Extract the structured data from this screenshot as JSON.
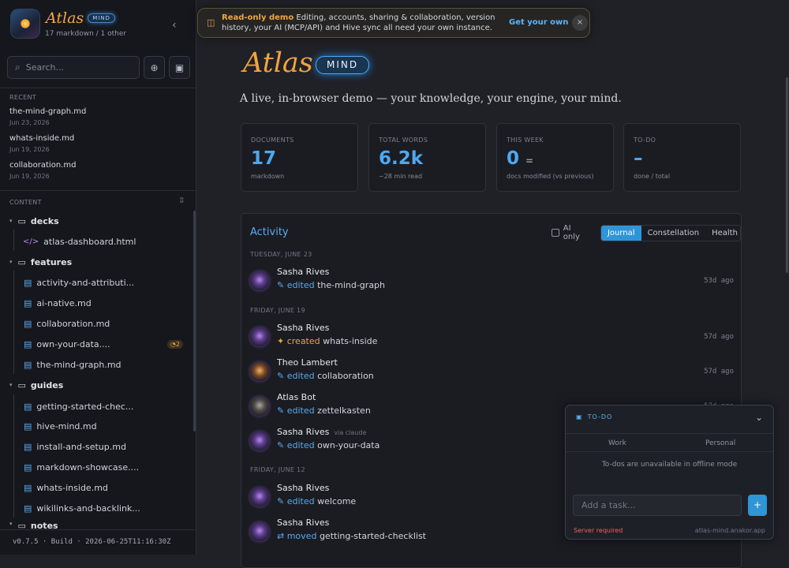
{
  "sidebar": {
    "app_name": "Atlas",
    "app_badge": "MIND",
    "doc_count": "17 markdown / 1 other",
    "search_placeholder": "Search...",
    "recent_label": "RECENT",
    "recent": [
      {
        "name": "the-mind-graph.md",
        "date": "Jun 23, 2026"
      },
      {
        "name": "whats-inside.md",
        "date": "Jun 19, 2026"
      },
      {
        "name": "collaboration.md",
        "date": "Jun 19, 2026"
      }
    ],
    "content_label": "CONTENT",
    "tree": [
      {
        "type": "folder",
        "label": "decks"
      },
      {
        "type": "html",
        "label": "atlas-dashboard.html"
      },
      {
        "type": "folder",
        "label": "features"
      },
      {
        "type": "file",
        "label": "activity-and-attributi..."
      },
      {
        "type": "file",
        "label": "ai-native.md"
      },
      {
        "type": "file",
        "label": "collaboration.md"
      },
      {
        "type": "file",
        "label": "own-your-data....",
        "comments": "2"
      },
      {
        "type": "file",
        "label": "the-mind-graph.md"
      },
      {
        "type": "folder",
        "label": "guides"
      },
      {
        "type": "file",
        "label": "getting-started-chec..."
      },
      {
        "type": "file",
        "label": "hive-mind.md"
      },
      {
        "type": "file",
        "label": "install-and-setup.md"
      },
      {
        "type": "file",
        "label": "markdown-showcase...."
      },
      {
        "type": "file",
        "label": "whats-inside.md"
      },
      {
        "type": "file",
        "label": "wikilinks-and-backlink..."
      },
      {
        "type": "folder",
        "label": "notes"
      }
    ],
    "footer": "v0.7.5 · Build · 2026-06-25T11:16:30Z"
  },
  "banner": {
    "bold": "Read-only demo",
    "text": "Editing, accounts, sharing & collaboration, version history, your AI (MCP/API) and Hive sync all need your own instance.",
    "cta": "Get your own ↗",
    "close": "×"
  },
  "hero": {
    "title": "Atlas",
    "badge": "MIND",
    "tagline": "A live, in-browser demo — your knowledge, your engine, your mind."
  },
  "stats": [
    {
      "label": "DOCUMENTS",
      "value": "17",
      "sub": "markdown"
    },
    {
      "label": "TOTAL WORDS",
      "value": "6.2k",
      "sub": "~28 min read"
    },
    {
      "label": "THIS WEEK",
      "value": "0",
      "delta": "=",
      "sub": "docs modified (vs previous)"
    },
    {
      "label": "TO-DO",
      "value": "–",
      "sub": "done / total"
    }
  ],
  "activity": {
    "title": "Activity",
    "ai_only": "AI only",
    "tabs": [
      "Journal",
      "Constellation",
      "Health"
    ],
    "active_tab": "Journal",
    "days": [
      {
        "day": "TUESDAY, JUNE 23",
        "entries": [
          {
            "name": "Sasha Rives",
            "verb": "edited",
            "target": "the-mind-graph",
            "when": "53d ago",
            "avatar": "purple"
          }
        ]
      },
      {
        "day": "FRIDAY, JUNE 19",
        "entries": [
          {
            "name": "Sasha Rives",
            "verb": "created",
            "target": "whats-inside",
            "when": "57d ago",
            "avatar": "purple"
          },
          {
            "name": "Theo Lambert",
            "verb": "edited",
            "target": "collaboration",
            "when": "57d ago",
            "avatar": "gold"
          },
          {
            "name": "Atlas Bot",
            "verb": "edited",
            "target": "zettelkasten",
            "when": "57d ago",
            "avatar": "bot"
          },
          {
            "name": "Sasha Rives",
            "via": "via claude",
            "verb": "edited",
            "target": "own-your-data",
            "when": "",
            "avatar": "purple"
          }
        ]
      },
      {
        "day": "FRIDAY, JUNE 12",
        "entries": [
          {
            "name": "Sasha Rives",
            "verb": "edited",
            "target": "welcome",
            "when": "",
            "avatar": "purple"
          },
          {
            "name": "Sasha Rives",
            "verb": "moved",
            "target": "getting-started-checklist",
            "when": "",
            "avatar": "purple"
          }
        ]
      }
    ]
  },
  "todo": {
    "title": "TO-DO",
    "tabs": [
      "Work",
      "Personal"
    ],
    "empty": "To-dos are unavailable in offline mode",
    "input_placeholder": "Add a task...",
    "add": "+",
    "error": "Server required",
    "url": "atlas-mind.anakor.app"
  }
}
